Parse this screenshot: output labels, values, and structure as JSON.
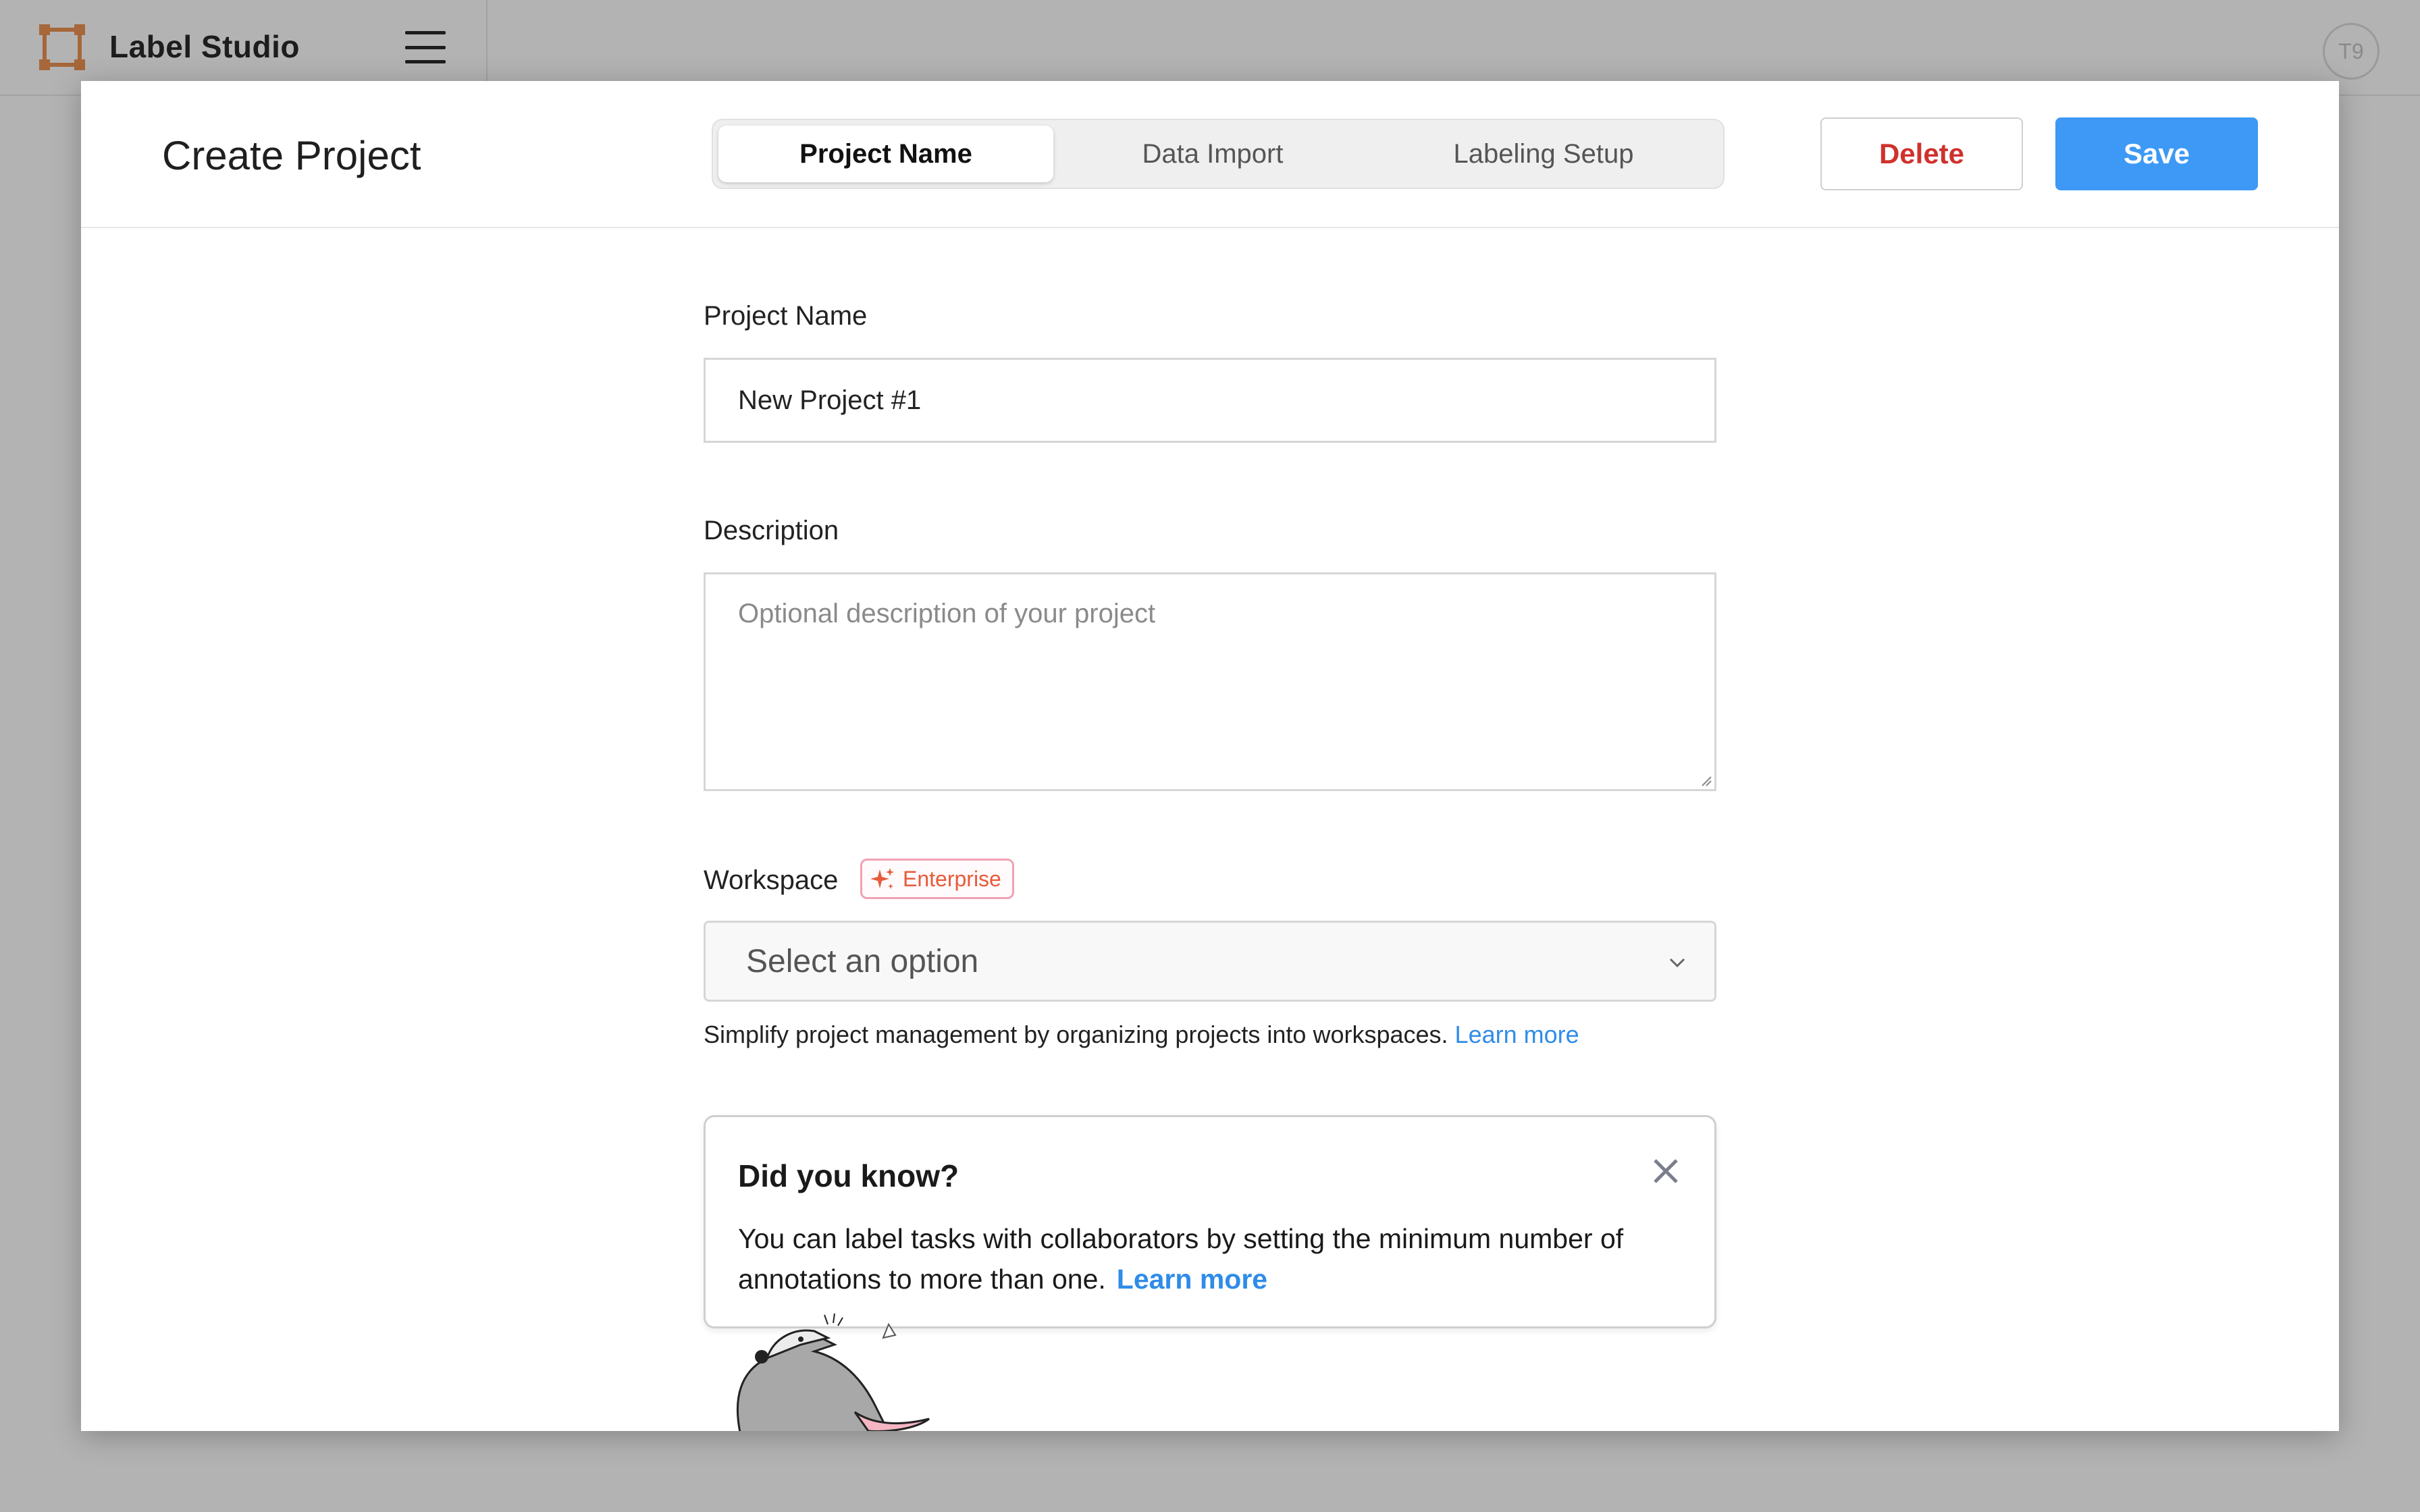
{
  "app": {
    "title": "Label Studio",
    "user_initials": "T9"
  },
  "modal": {
    "title": "Create Project",
    "tabs": [
      {
        "label": "Project Name",
        "active": true
      },
      {
        "label": "Data Import",
        "active": false
      },
      {
        "label": "Labeling Setup",
        "active": false
      }
    ],
    "delete_label": "Delete",
    "save_label": "Save"
  },
  "form": {
    "project_name_label": "Project Name",
    "project_name_value": "New Project #1",
    "description_label": "Description",
    "description_placeholder": "Optional description of your project",
    "workspace_label": "Workspace",
    "enterprise_badge": "Enterprise",
    "workspace_select_value": "Select an option",
    "workspace_hint": "Simplify project management by organizing projects into workspaces.",
    "workspace_hint_link": "Learn more"
  },
  "tip": {
    "title": "Did you know?",
    "body": "You can label tasks with collaborators by setting the minimum number of annotations to more than one.",
    "link": "Learn more"
  },
  "colors": {
    "accent": "#3d99f5",
    "danger": "#d0312d",
    "link": "#2f8ce8",
    "logo": "#c06a2b",
    "enterprise": "#e85a3a"
  },
  "icons": {
    "logo": "label-studio-logo-icon",
    "menu": "hamburger-menu-icon",
    "sparkle": "sparkle-icon",
    "chevron": "chevron-down-icon",
    "close": "close-icon",
    "mascot": "opossum-mascot-illustration"
  }
}
